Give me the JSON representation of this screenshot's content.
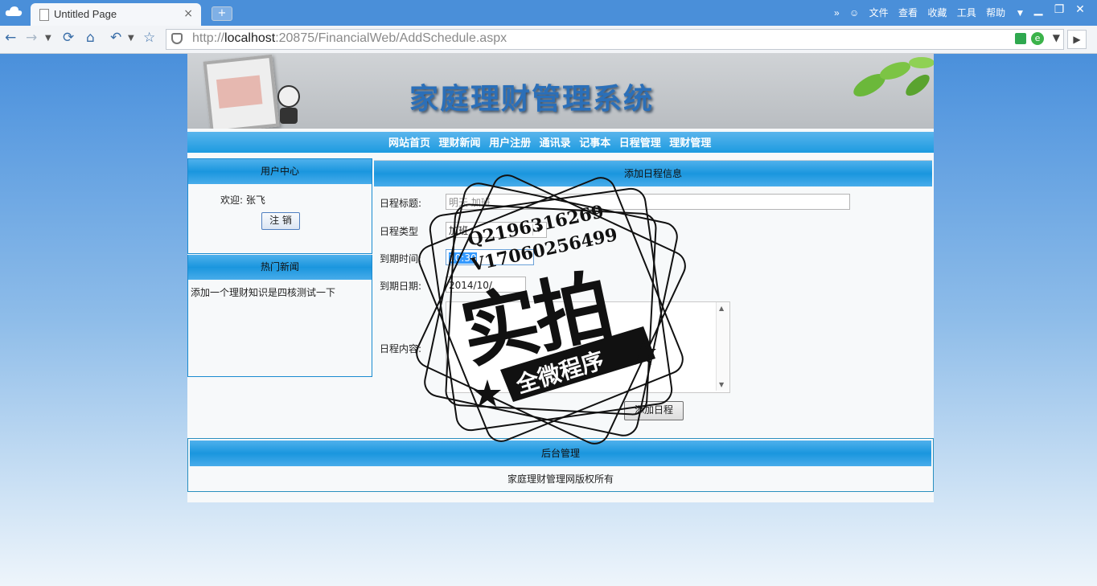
{
  "browser": {
    "tab_title": "Untitled Page",
    "tab_close": "×",
    "new_tab": "+",
    "url_host": "localhost",
    "url_prefix": "http://",
    "url_rest": ":20875/FinancialWeb/AddSchedule.aspx",
    "menus": [
      "文件",
      "查看",
      "收藏",
      "工具",
      "帮助"
    ],
    "menu_more": "»"
  },
  "site": {
    "banner_title": "家庭理财管理系统",
    "nav": [
      "网站首页",
      "理财新闻",
      "用户注册",
      "通讯录",
      "记事本",
      "日程管理",
      "理财管理"
    ]
  },
  "user_center": {
    "header": "用户中心",
    "welcome": "欢迎: 张飞",
    "logout_label": "注 销"
  },
  "hot_news": {
    "header": "热门新闻",
    "items": [
      "添加一个理财知识是四核测试一下"
    ]
  },
  "form": {
    "header": "添加日程信息",
    "title_label": "日程标题:",
    "title_value": "明天 加班",
    "type_label": "日程类型",
    "type_value": "加班",
    "time_label": "到期时间:",
    "time_value": "10:30",
    "date_label": "到期日期:",
    "date_value": "2014/10/",
    "content_label": "日程内容:",
    "submit_label": "添加日程"
  },
  "footer": {
    "header": "后台管理",
    "copyright": "家庭理财管理网版权所有"
  },
  "watermark": {
    "line1": "Q2196316269",
    "line2": "V17060256499",
    "big": "实拍",
    "ribbon": "全微程序"
  },
  "colors": {
    "nav_blue": "#1c9be0",
    "browser_blue": "#4a8fd9"
  }
}
